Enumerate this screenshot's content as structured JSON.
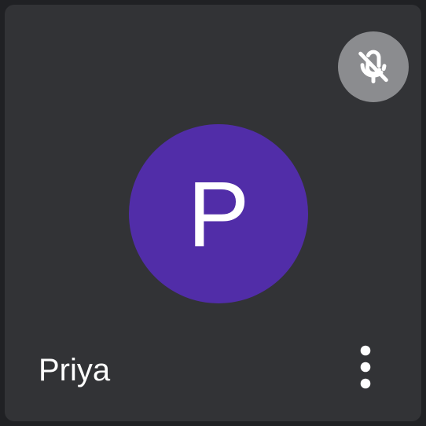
{
  "participant": {
    "name": "Priya",
    "initial": "P",
    "avatar_color": "#512da8",
    "muted": true
  },
  "icons": {
    "mute_status": "microphone-off-icon",
    "options": "more-vert-icon"
  },
  "colors": {
    "tile_background": "#323336",
    "mute_badge_background": "#8b8c8f",
    "text": "#ffffff"
  }
}
